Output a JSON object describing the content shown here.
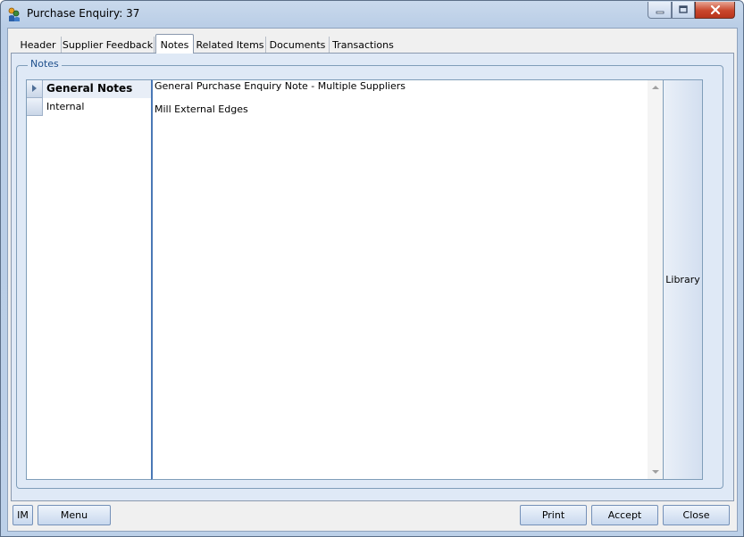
{
  "window": {
    "title": "Purchase Enquiry: 37"
  },
  "tabs": [
    {
      "label": "Header"
    },
    {
      "label": "Supplier Feedback"
    },
    {
      "label": "Notes"
    },
    {
      "label": "Related Items"
    },
    {
      "label": "Documents"
    },
    {
      "label": "Transactions"
    }
  ],
  "active_tab": "Notes",
  "notes_group": {
    "label": "Notes",
    "categories": [
      {
        "label": "General Notes",
        "selected": true
      },
      {
        "label": "Internal",
        "selected": false
      }
    ],
    "editor_lines": [
      "General Purchase Enquiry Note - Multiple Suppliers",
      "Mill External Edges"
    ],
    "library_label": "Library"
  },
  "footer": {
    "im_label": "IM",
    "menu_label": "Menu",
    "print_label": "Print",
    "accept_label": "Accept",
    "close_label": "Close"
  },
  "colors": {
    "accent": "#4a78b6",
    "frame": "#bcd0e8",
    "tabpage_bg": "#dfe9f6",
    "close_button": "#c9462c"
  },
  "icons": [
    "app-icon",
    "minimize-icon",
    "maximize-icon",
    "close-icon",
    "row-pointer-icon",
    "scroll-up-icon",
    "scroll-down-icon"
  ]
}
